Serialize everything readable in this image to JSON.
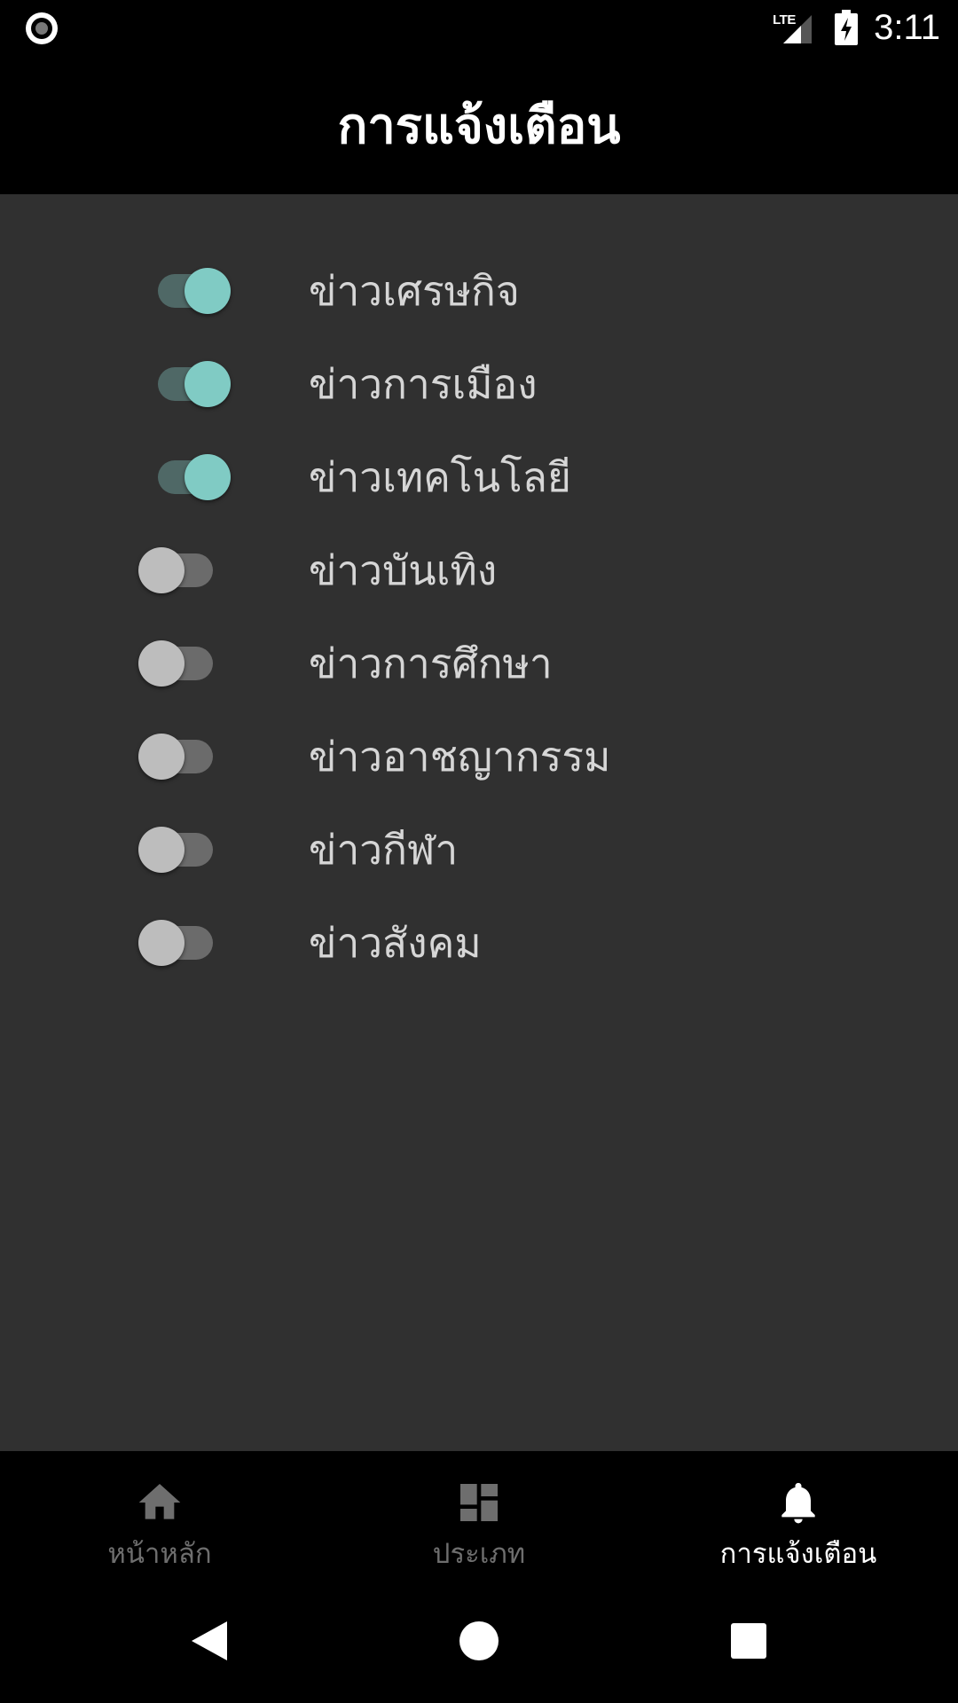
{
  "status_bar": {
    "network": "LTE",
    "time": "3:11",
    "icons": [
      "record-icon",
      "lte-signal-icon",
      "battery-charging-icon"
    ]
  },
  "app_bar": {
    "title": "การแจ้งเตือน"
  },
  "settings": [
    {
      "label": "ข่าวเศรษกิจ",
      "enabled": true
    },
    {
      "label": "ข่าวการเมือง",
      "enabled": true
    },
    {
      "label": "ข่าวเทคโนโลยี",
      "enabled": true
    },
    {
      "label": "ข่าวบันเทิง",
      "enabled": false
    },
    {
      "label": "ข่าวการศึกษา",
      "enabled": false
    },
    {
      "label": "ข่าวอาชญากรรม",
      "enabled": false
    },
    {
      "label": "ข่าวกีฬา",
      "enabled": false
    },
    {
      "label": "ข่าวสังคม",
      "enabled": false
    }
  ],
  "bottom_nav": {
    "items": [
      {
        "label": "หน้าหลัก",
        "icon": "home-icon",
        "active": false
      },
      {
        "label": "ประเภท",
        "icon": "dashboard-icon",
        "active": false
      },
      {
        "label": "การแจ้งเตือน",
        "icon": "bell-icon",
        "active": true
      }
    ]
  },
  "system_nav": {
    "buttons": [
      "back-icon",
      "home-circle-icon",
      "recents-icon"
    ]
  },
  "colors": {
    "background": "#303030",
    "bars": "#000000",
    "switch_on_thumb": "#80cbc4",
    "switch_on_track": "#4f6866",
    "switch_off_thumb": "#bdbdbd",
    "switch_off_track": "#6b6b6b",
    "label_text": "#d6d6d6",
    "nav_inactive": "#6e6e6e",
    "nav_active": "#ffffff"
  }
}
